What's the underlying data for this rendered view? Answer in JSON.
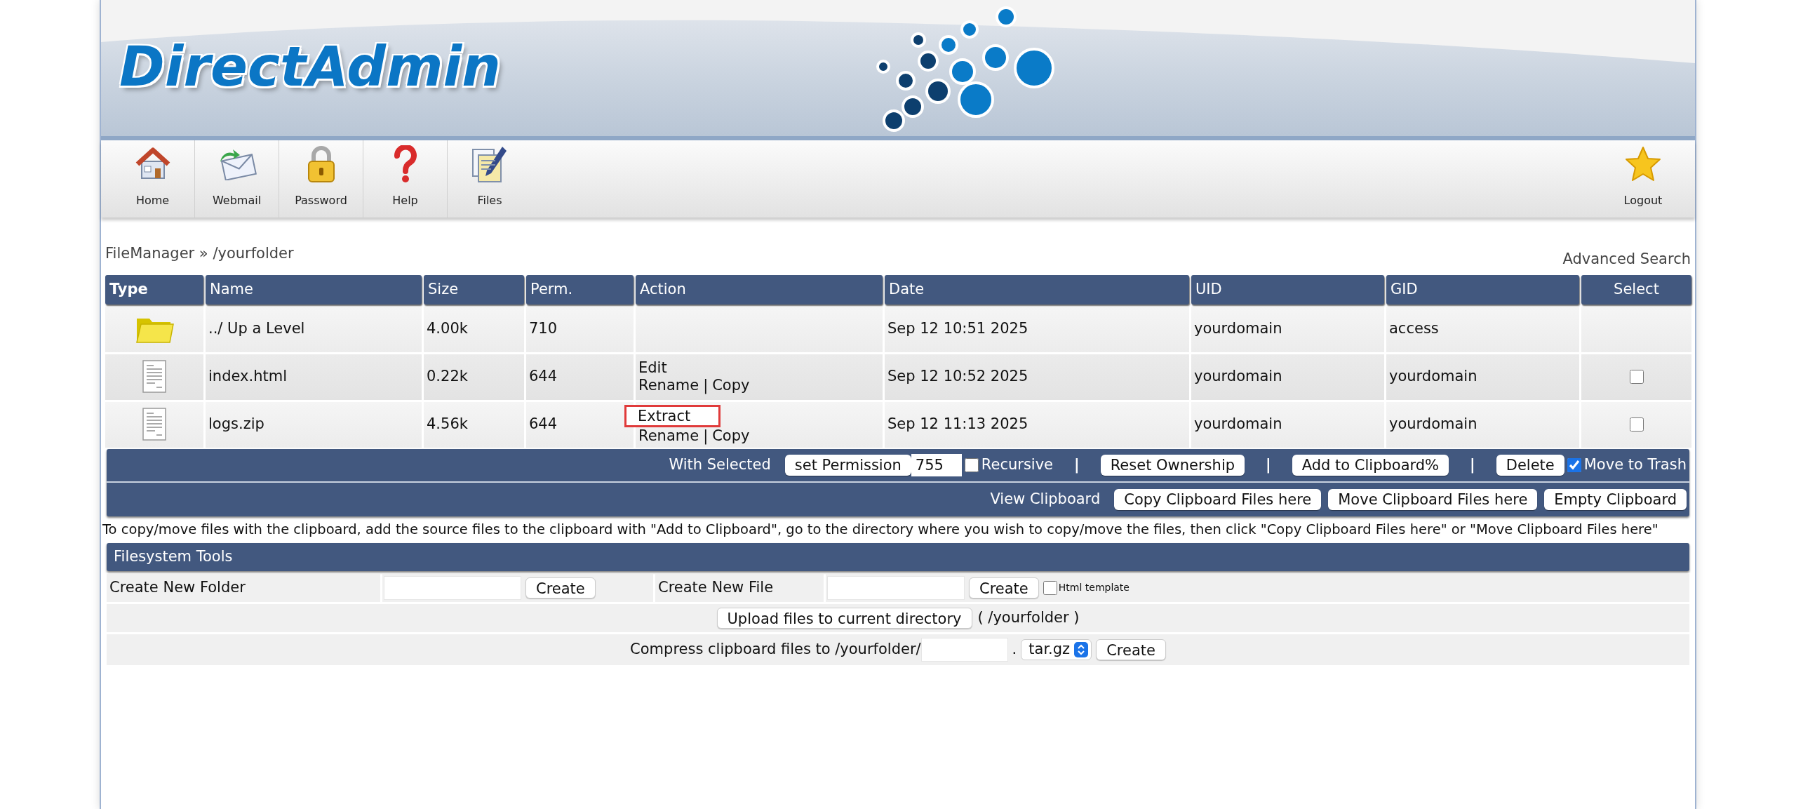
{
  "header": {
    "logo": "DirectAdmin"
  },
  "toolbar": {
    "items": [
      {
        "label": "Home",
        "kind": "home"
      },
      {
        "label": "Webmail",
        "kind": "webmail"
      },
      {
        "label": "Password",
        "kind": "password"
      },
      {
        "label": "Help",
        "kind": "help"
      },
      {
        "label": "Files",
        "kind": "files"
      }
    ],
    "logout": {
      "label": "Logout"
    }
  },
  "breadcrumb": "FileManager » /yourfolder",
  "advanced_search": "Advanced Search",
  "table": {
    "columns": [
      "Type",
      "Name",
      "Size",
      "Perm.",
      "Action",
      "Date",
      "UID",
      "GID",
      "Select"
    ],
    "rows": [
      {
        "kind": "folder",
        "name": "../ Up a Level",
        "size": "4.00k",
        "perm": "710",
        "actions": [],
        "date": "Sep 12 10:51 2025",
        "uid": "yourdomain",
        "gid": "access"
      },
      {
        "kind": "file",
        "name": "index.html",
        "size": "0.22k",
        "perm": "644",
        "actions": [
          [
            {
              "text": "Edit",
              "kind": "link",
              "highlighted": false
            }
          ],
          [
            {
              "text": "Rename",
              "kind": "link",
              "highlighted": false
            },
            {
              "text": "|",
              "kind": "separator"
            },
            {
              "text": "Copy",
              "kind": "link",
              "highlighted": false
            }
          ]
        ],
        "date": "Sep 12 10:52 2025",
        "uid": "yourdomain",
        "gid": "yourdomain",
        "checked": false
      },
      {
        "kind": "file",
        "name": "logs.zip",
        "size": "4.56k",
        "perm": "644",
        "actions": [
          [
            {
              "text": "Extract",
              "kind": "link",
              "highlighted": true
            }
          ],
          [
            {
              "text": "Rename",
              "kind": "link",
              "highlighted": false
            },
            {
              "text": "|",
              "kind": "separator"
            },
            {
              "text": "Copy",
              "kind": "link",
              "highlighted": false
            }
          ]
        ],
        "date": "Sep 12 11:13 2025",
        "uid": "yourdomain",
        "gid": "yourdomain",
        "checked": false
      }
    ]
  },
  "action_bar": {
    "lines": [
      [
        {
          "kind": "label",
          "text": "With Selected"
        },
        {
          "kind": "button",
          "text": "set Permission"
        },
        {
          "kind": "input",
          "value": "755"
        },
        {
          "kind": "checkbox",
          "text": "Recursive",
          "checked": false
        },
        {
          "kind": "separator",
          "text": "|"
        },
        {
          "kind": "button",
          "text": "Reset Ownership"
        },
        {
          "kind": "separator",
          "text": "|"
        },
        {
          "kind": "button",
          "text": "Add to Clipboard%"
        },
        {
          "kind": "separator",
          "text": "|"
        },
        {
          "kind": "button",
          "text": "Delete"
        },
        {
          "kind": "checkbox",
          "text": "Move to Trash",
          "checked": true
        }
      ],
      [
        {
          "kind": "label",
          "text": "View Clipboard"
        },
        {
          "kind": "button",
          "text": "Copy Clipboard Files here"
        },
        {
          "kind": "button",
          "text": "Move Clipboard Files here"
        },
        {
          "kind": "button",
          "text": "Empty Clipboard"
        }
      ]
    ]
  },
  "help_text": "To copy/move files with the clipboard, add the source files to the clipboard with \"Add to Clipboard\", go to the directory where you wish to copy/move the files, then click \"Copy Clipboard Files here\" or \"Move Clipboard Files here\"",
  "filesystem_tools": {
    "title": "Filesystem Tools",
    "create_folder": {
      "label": "Create New Folder",
      "button": "Create"
    },
    "create_file": {
      "label": "Create New File",
      "button": "Create",
      "template_label": "Html template",
      "template_checked": false
    },
    "upload": {
      "button": "Upload files to current directory",
      "path": "( /yourfolder )"
    },
    "compress": {
      "label": "Compress clipboard files to /yourfolder/",
      "dot": ".",
      "format": "tar.gz",
      "button": "Create"
    }
  }
}
